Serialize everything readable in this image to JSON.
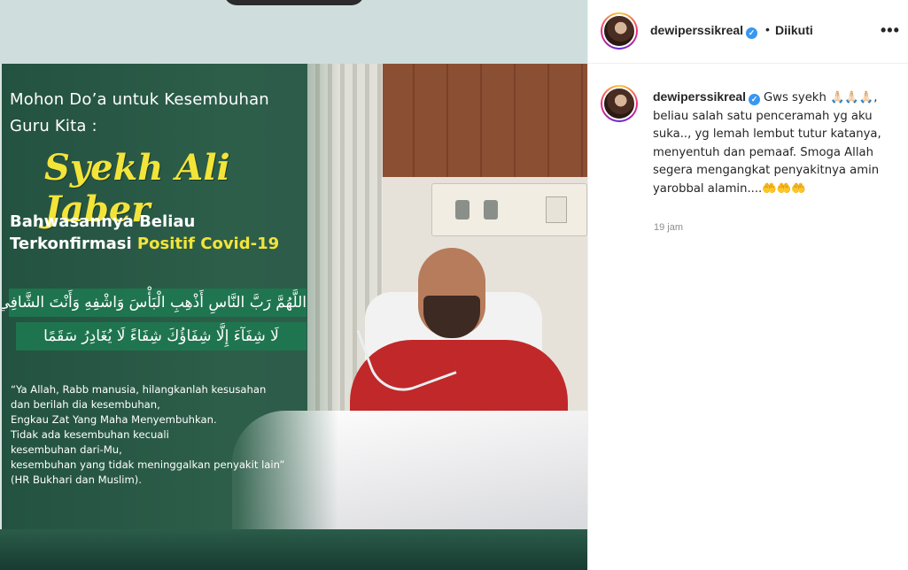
{
  "poster": {
    "line1": "Mohon Do’a untuk Kesembuhan",
    "line2": "Guru Kita :",
    "name": "Syekh Ali Jaber",
    "line3": "Bahwasannya Beliau",
    "line4_prefix": "Terkonfirmasi ",
    "line4_highlight": "Positif Covid-19",
    "arabic1": "اللَّهُمَّ رَبَّ النَّاسِ أَذْهِبِ الْبَأْسَ وَاشْفِهِ وَأَنْتَ الشَّافِي",
    "arabic2": "لَا شِفَآءَ إِلَّا شِفَاؤُكَ شِفَاءً لَا يُغَادِرُ سَقَمًا",
    "quote_lines": [
      "“Ya Allah, Rabb manusia, hilangkanlah kesusahan",
      "dan berilah dia kesembuhan,",
      "Engkau Zat Yang Maha Menyembuhkan.",
      "Tidak ada kesembuhan kecuali",
      "kesembuhan dari-Mu,",
      "kesembuhan yang tidak meninggalkan penyakit lain”",
      "(HR Bukhari dan Muslim)."
    ]
  },
  "header": {
    "username": "dewiperssikreal",
    "dot": "•",
    "follow_status": "Diikuti",
    "more": "•••"
  },
  "caption": {
    "username": "dewiperssikreal",
    "text": "Gws syekh 🙏🏻🙏🏻🙏🏻, beliau salah satu penceramah yg aku suka.., yg lemah lembut tutur katanya, menyentuh dan pemaaf. Smoga Allah segera mengangkat penyakitnya amin yarobbal alamin....🤲🤲🤲",
    "time": "19 jam"
  },
  "colors": {
    "poster_green": "#2d5a4a",
    "highlight_yellow": "#f3e43a",
    "verified_blue": "#3897f0",
    "shirt_red": "#c0282a"
  }
}
